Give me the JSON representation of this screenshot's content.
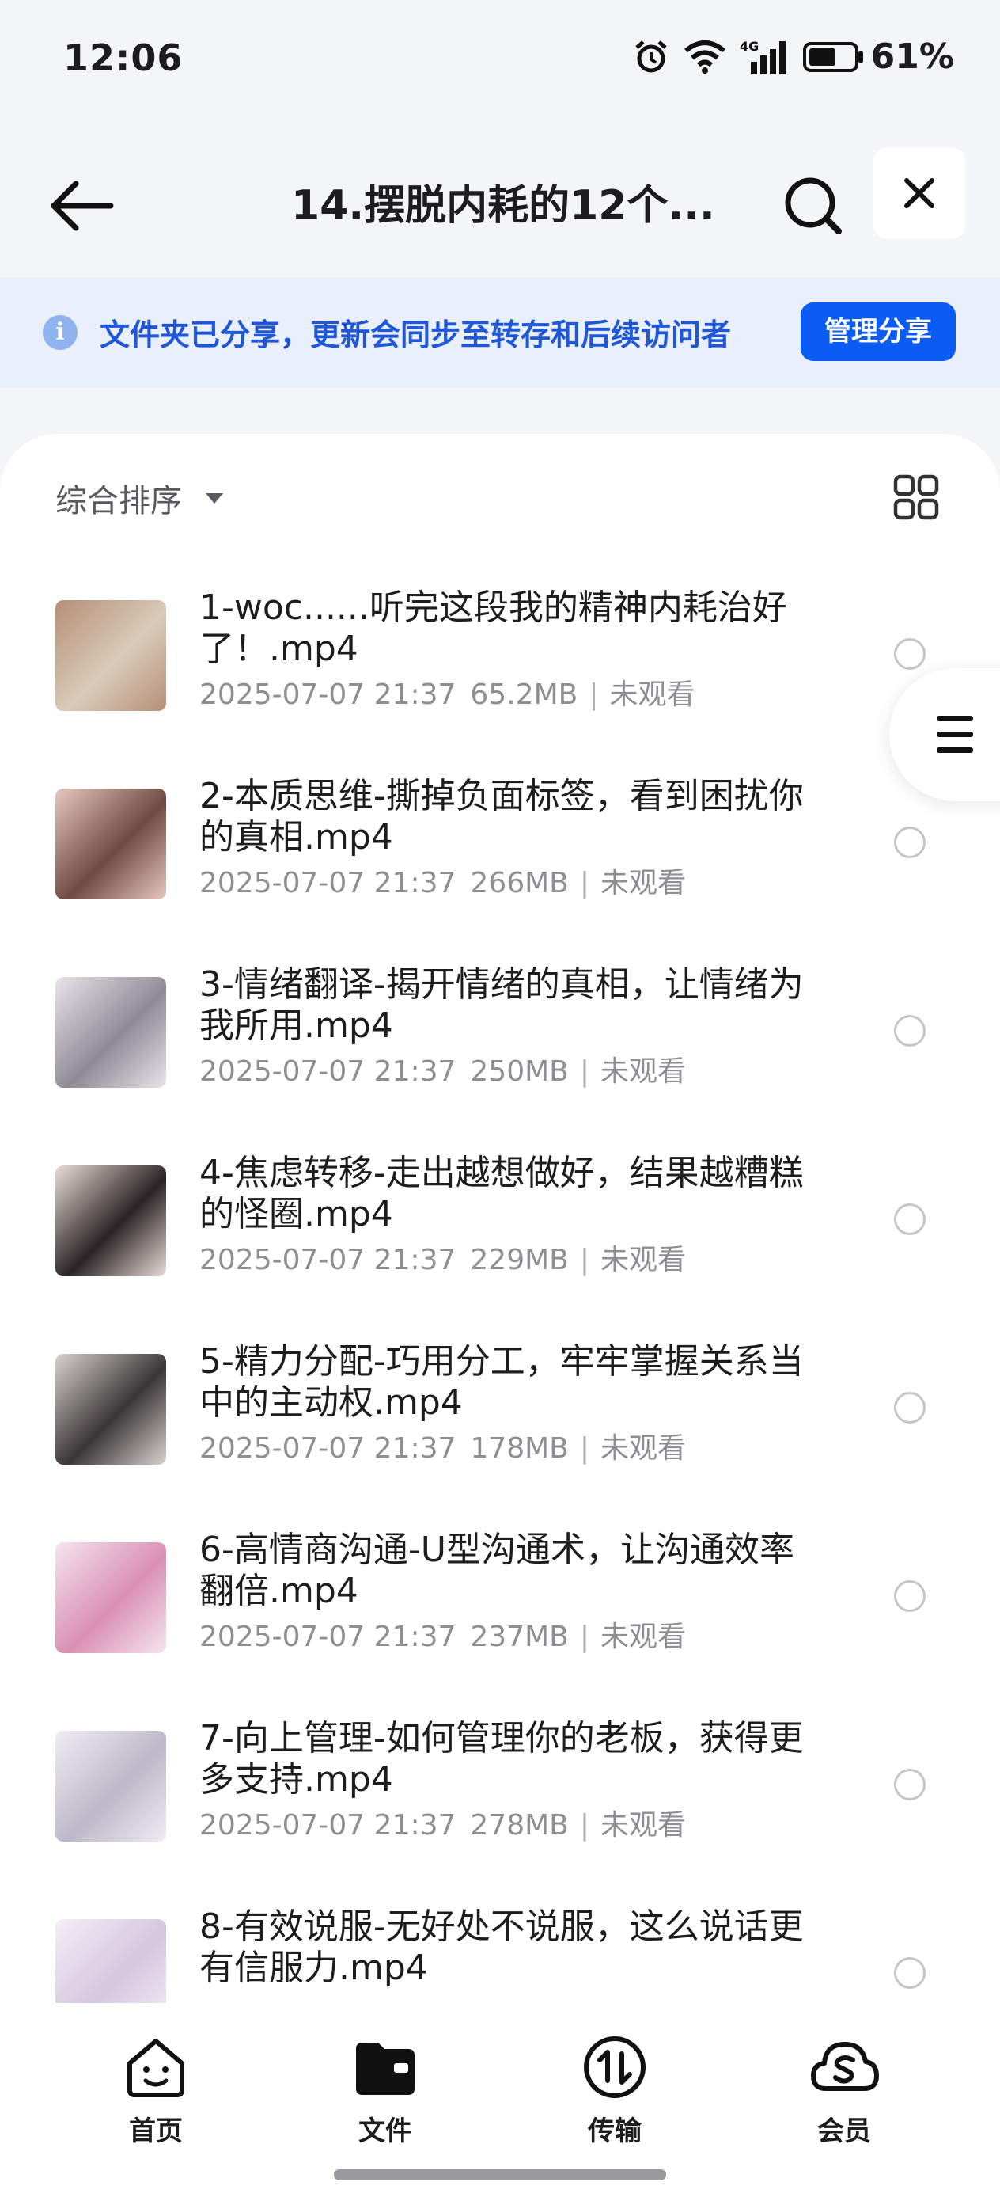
{
  "status_bar": {
    "time": "12:06",
    "network": "4G",
    "battery_percent": "61%",
    "battery_level": 0.61,
    "icons": [
      "alarm-icon",
      "wifi-icon",
      "signal-icon",
      "battery-icon"
    ]
  },
  "header": {
    "title": "14.摆脱内耗的12个...",
    "back_icon": "back-arrow-icon",
    "search_icon": "search-icon",
    "close_icon": "close-icon"
  },
  "banner": {
    "text": "文件夹已分享，更新会同步至转存和后续访问者",
    "button_label": "管理分享",
    "accent": "#0a5cf5"
  },
  "list_header": {
    "sort_label": "综合排序",
    "view_icon": "grid-view-icon"
  },
  "files": [
    {
      "name": "1-woc......听完这段我的精神内耗治好了！.mp4",
      "date": "2025-07-07 21:37",
      "size": "65.2MB",
      "status": "未观看"
    },
    {
      "name": "2-本质思维-撕掉负面标签，看到困扰你的真相.mp4",
      "date": "2025-07-07 21:37",
      "size": "266MB",
      "status": "未观看"
    },
    {
      "name": "3-情绪翻译-揭开情绪的真相，让情绪为我所用.mp4",
      "date": "2025-07-07 21:37",
      "size": "250MB",
      "status": "未观看"
    },
    {
      "name": "4-焦虑转移-走出越想做好，结果越糟糕的怪圈.mp4",
      "date": "2025-07-07 21:37",
      "size": "229MB",
      "status": "未观看"
    },
    {
      "name": "5-精力分配-巧用分工，牢牢掌握关系当中的主动权.mp4",
      "date": "2025-07-07 21:37",
      "size": "178MB",
      "status": "未观看"
    },
    {
      "name": "6-高情商沟通-U型沟通术，让沟通效率翻倍.mp4",
      "date": "2025-07-07 21:37",
      "size": "237MB",
      "status": "未观看"
    },
    {
      "name": "7-向上管理-如何管理你的老板，获得更多支持.mp4",
      "date": "2025-07-07 21:37",
      "size": "278MB",
      "status": "未观看"
    },
    {
      "name": "8-有效说服-无好处不说服，这么说话更有信服力.mp4",
      "date": "",
      "size": "",
      "status": ""
    }
  ],
  "tabbar": {
    "tabs": [
      {
        "label": "首页",
        "icon": "home-face-icon"
      },
      {
        "label": "文件",
        "icon": "folder-icon",
        "active": true
      },
      {
        "label": "传输",
        "icon": "transfer-icon"
      },
      {
        "label": "会员",
        "icon": "vip-cloud-icon"
      }
    ]
  }
}
